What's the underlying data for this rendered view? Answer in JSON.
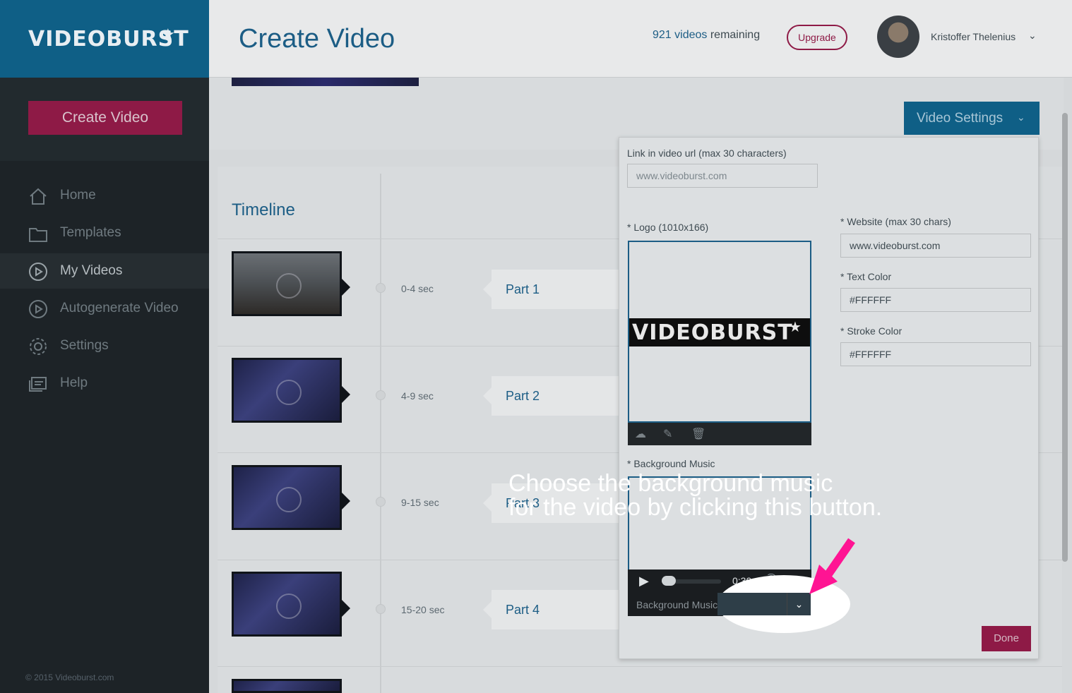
{
  "app": {
    "logo_text": "VIDEOBURST",
    "logo_star": "★",
    "copyright": "© 2015 Videoburst.com"
  },
  "sidebar": {
    "create_button": "Create Video",
    "items": [
      {
        "label": "Home",
        "icon": "home-icon"
      },
      {
        "label": "Templates",
        "icon": "folder-icon"
      },
      {
        "label": "My Videos",
        "icon": "play-circle-icon",
        "active": true
      },
      {
        "label": "Autogenerate Video",
        "icon": "play-circle-icon"
      },
      {
        "label": "Settings",
        "icon": "gear-icon"
      },
      {
        "label": "Help",
        "icon": "help-icon"
      }
    ]
  },
  "header": {
    "title": "Create Video",
    "videos_count": "921 videos",
    "videos_suffix": " remaining",
    "upgrade_label": "Upgrade",
    "user_name": "Kristoffer Thelenius",
    "user_chevron": "⌄"
  },
  "main": {
    "video_settings_label": "Video Settings",
    "video_settings_chevron": "⌄",
    "timeline_title": "Timeline",
    "timeline": [
      {
        "seconds": "0-4 sec",
        "part": "Part 1"
      },
      {
        "seconds": "4-9 sec",
        "part": "Part 2"
      },
      {
        "seconds": "9-15 sec",
        "part": "Part 3"
      },
      {
        "seconds": "15-20 sec",
        "part": "Part 4"
      }
    ]
  },
  "settings": {
    "link_label": "Link in video url (max 30 characters)",
    "link_placeholder": "www.videoburst.com",
    "logo_label": "* Logo (1010x166)",
    "logo_banner_text": "VIDEOBURST",
    "logo_banner_star": "★",
    "website_label": "* Website (max 30 chars)",
    "website_value": "www.videoburst.com",
    "text_color_label": "* Text Color",
    "text_color_value": "#FFFFFF",
    "stroke_color_label": "* Stroke Color",
    "stroke_color_value": "#FFFFFF",
    "music_label": "* Background Music",
    "audio_time": "0:30",
    "music_select_label": "Background Music",
    "done_label": "Done"
  },
  "tutorial": {
    "line1": "Choose the background music",
    "line2": "for the video by clicking this button."
  },
  "colors": {
    "brand_blue": "#0f5f86",
    "brand_pink": "#8e1a46",
    "pointer_pink": "#ff1493"
  }
}
